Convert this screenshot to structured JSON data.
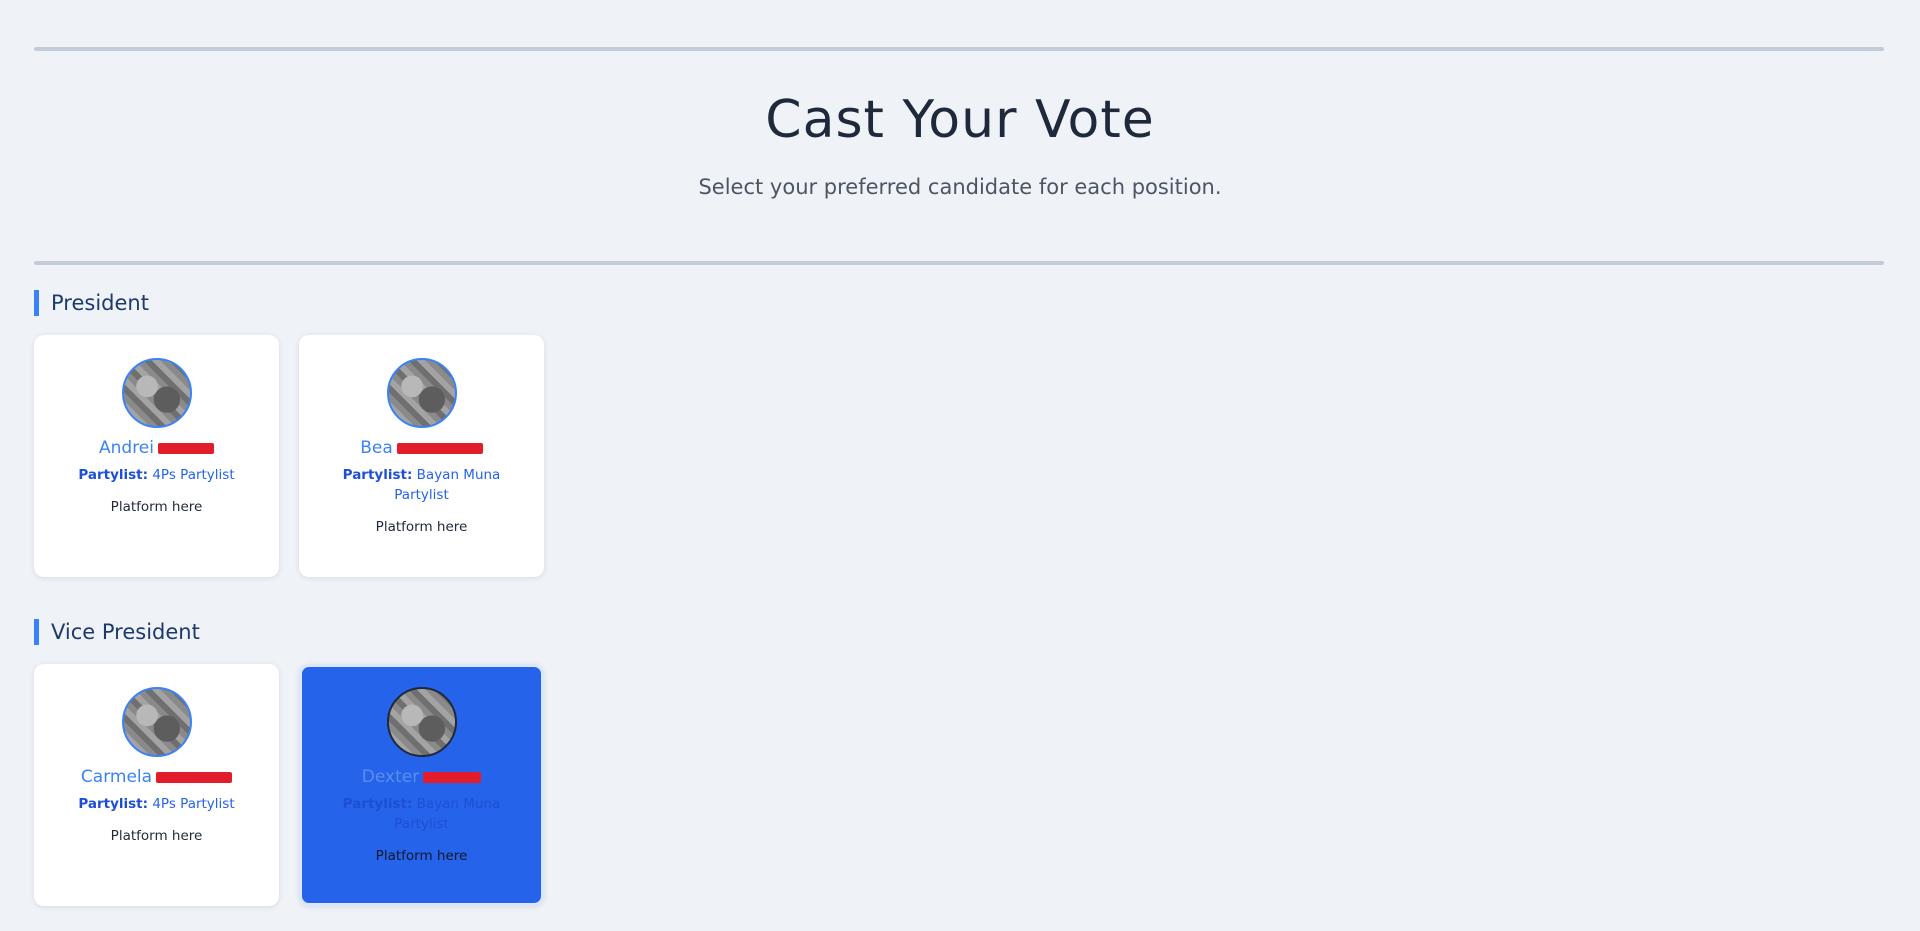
{
  "header": {
    "title": "Cast Your Vote",
    "subtitle": "Select your preferred candidate for each position."
  },
  "positions": [
    {
      "title": "President",
      "candidates": [
        {
          "first_name": "Andrei",
          "partylist_label": "Partylist:",
          "partylist": "4Ps Partylist",
          "platform": "Platform here",
          "selected": false
        },
        {
          "first_name": "Bea",
          "partylist_label": "Partylist:",
          "partylist": "Bayan Muna Partylist",
          "platform": "Platform here",
          "selected": false
        }
      ]
    },
    {
      "title": "Vice President",
      "candidates": [
        {
          "first_name": "Carmela",
          "partylist_label": "Partylist:",
          "partylist": "4Ps Partylist",
          "platform": "Platform here",
          "selected": false
        },
        {
          "first_name": "Dexter",
          "partylist_label": "Partylist:",
          "partylist": "Bayan Muna Partylist",
          "platform": "Platform here",
          "selected": true
        }
      ]
    }
  ],
  "colors": {
    "accent": "#3b82f6",
    "selected_card": "#2563eb",
    "background": "#eff3f8",
    "redaction": "#e11d2c"
  }
}
